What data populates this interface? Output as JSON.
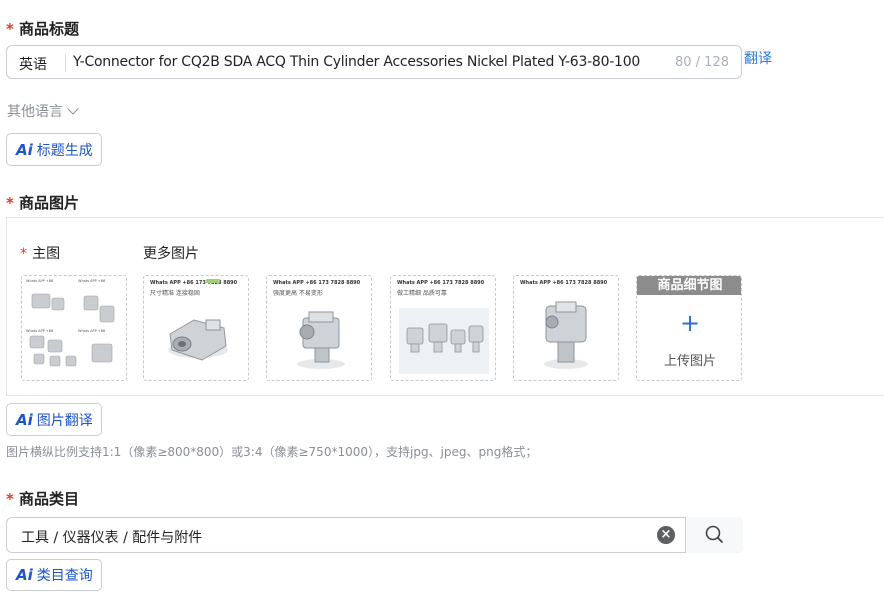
{
  "title_section": {
    "required_mark": "*",
    "label": "商品标题",
    "lang": "英语",
    "value": "Y-Connector for CQ2B SDA ACQ Thin Cylinder Accessories Nickel Plated Y-63-80-100",
    "counter": "80 / 128",
    "translate_link": "翻译",
    "other_languages": "其他语言",
    "ai_button": {
      "logo": "Ai",
      "label": "标题生成"
    }
  },
  "image_section": {
    "required_mark": "*",
    "label": "商品图片",
    "main_image_required": "*",
    "main_image_label": "主图",
    "more_images_label": "更多图片",
    "thumb_texts": [
      {
        "caption": "Whats APP +86 173 7828 8890",
        "sub": "尺寸精准 连接稳固"
      },
      {
        "caption": "Whats APP +86 173 7828 8890",
        "sub": "尺寸精准 连接稳固"
      },
      {
        "caption": "Whats APP +86 173 7828 8890",
        "sub": "强度更高 不易变形"
      },
      {
        "caption": "Whats APP +86 173 7828 8890",
        "sub": "做工精细 品质可靠"
      },
      {
        "caption": "Whats APP +86 173 7828 8890",
        "sub": ""
      }
    ],
    "detail_header": "商品细节图",
    "upload_plus": "+",
    "upload_label": "上传图片",
    "ai_button": {
      "logo": "Ai",
      "label": "图片翻译"
    },
    "hint": "图片横纵比例支持1:1（像素≥800*800）或3:4（像素≥750*1000），支持jpg、jpeg、png格式；"
  },
  "category_section": {
    "required_mark": "*",
    "label": "商品类目",
    "value": "工具 / 仪器仪表 / 配件与附件",
    "clear_icon": "×",
    "ai_button": {
      "logo": "Ai",
      "label": "类目查询"
    }
  },
  "colors": {
    "accent": "#1d54c9",
    "link": "#2b7bd6",
    "required": "#e23c2c"
  }
}
